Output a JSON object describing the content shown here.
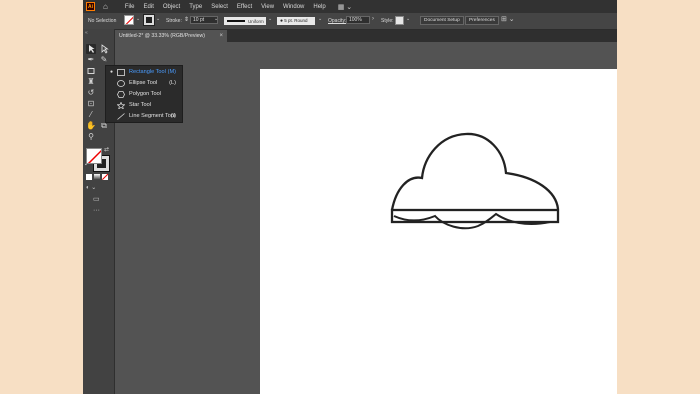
{
  "app": {
    "logo": "Ai",
    "menu": [
      "File",
      "Edit",
      "Object",
      "Type",
      "Select",
      "Effect",
      "View",
      "Window",
      "Help"
    ]
  },
  "control_bar": {
    "selection_status": "No Selection",
    "stroke_label": "Stroke:",
    "stroke_weight": "10 pt",
    "profile": "Uniform",
    "brush": "5 pt. Round",
    "opacity_label": "Opacity:",
    "opacity_value": "100%",
    "style_label": "Style:",
    "document_setup": "Document Setup",
    "preferences": "Preferences"
  },
  "document": {
    "tab_title": "Untitled-2* @ 33.33% (RGB/Preview)"
  },
  "flyout": {
    "items": [
      {
        "label": "Rectangle Tool",
        "shortcut": "(M)",
        "selected": true
      },
      {
        "label": "Ellipse Tool",
        "shortcut": "(L)",
        "selected": false
      },
      {
        "label": "Polygon Tool",
        "shortcut": "",
        "selected": false
      },
      {
        "label": "Star Tool",
        "shortcut": "",
        "selected": false
      },
      {
        "label": "Line Segment Tool",
        "shortcut": "(\\)",
        "selected": false
      }
    ]
  },
  "colors": {
    "page_background": "#f7dfc4",
    "ui_dark": "#323232",
    "ui_panel": "#535353",
    "accent": "#4a9cff",
    "artwork_stroke": "#222222"
  },
  "icons": {
    "home": "home-icon",
    "workspace": "workspace-grid-icon",
    "selection": "selection-tool-icon",
    "direct_selection": "direct-selection-tool-icon",
    "pen": "pen-tool-icon",
    "rectangle": "rectangle-tool-icon",
    "rotate": "rotate-tool-icon",
    "eyedropper": "eyedropper-tool-icon",
    "hand": "hand-tool-icon",
    "zoom": "zoom-tool-icon"
  }
}
